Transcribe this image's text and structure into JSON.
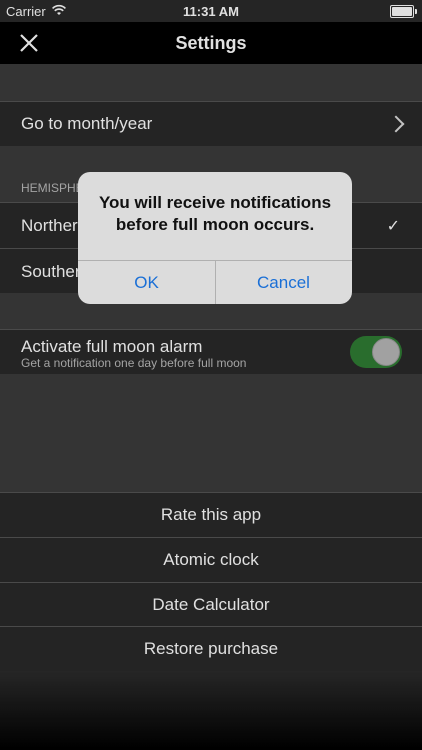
{
  "status": {
    "carrier": "Carrier",
    "time": "11:31 AM"
  },
  "nav": {
    "title": "Settings"
  },
  "goto": {
    "label": "Go to month/year"
  },
  "hemisphere": {
    "header": "HEMISPHERE",
    "north_label": "Northern",
    "south_label": "Southern",
    "selected_mark": "✓"
  },
  "alarm": {
    "label": "Activate full moon alarm",
    "sublabel": "Get a notification one day before full moon",
    "enabled": true
  },
  "actions": {
    "rate": "Rate this app",
    "atomic": "Atomic clock",
    "date_calc": "Date Calculator",
    "restore": "Restore purchase"
  },
  "alert": {
    "message": "You will receive notifications before full moon occurs.",
    "ok": "OK",
    "cancel": "Cancel"
  },
  "colors": {
    "toggle_on": "#2f7d34",
    "alert_button": "#1a6fd6"
  }
}
